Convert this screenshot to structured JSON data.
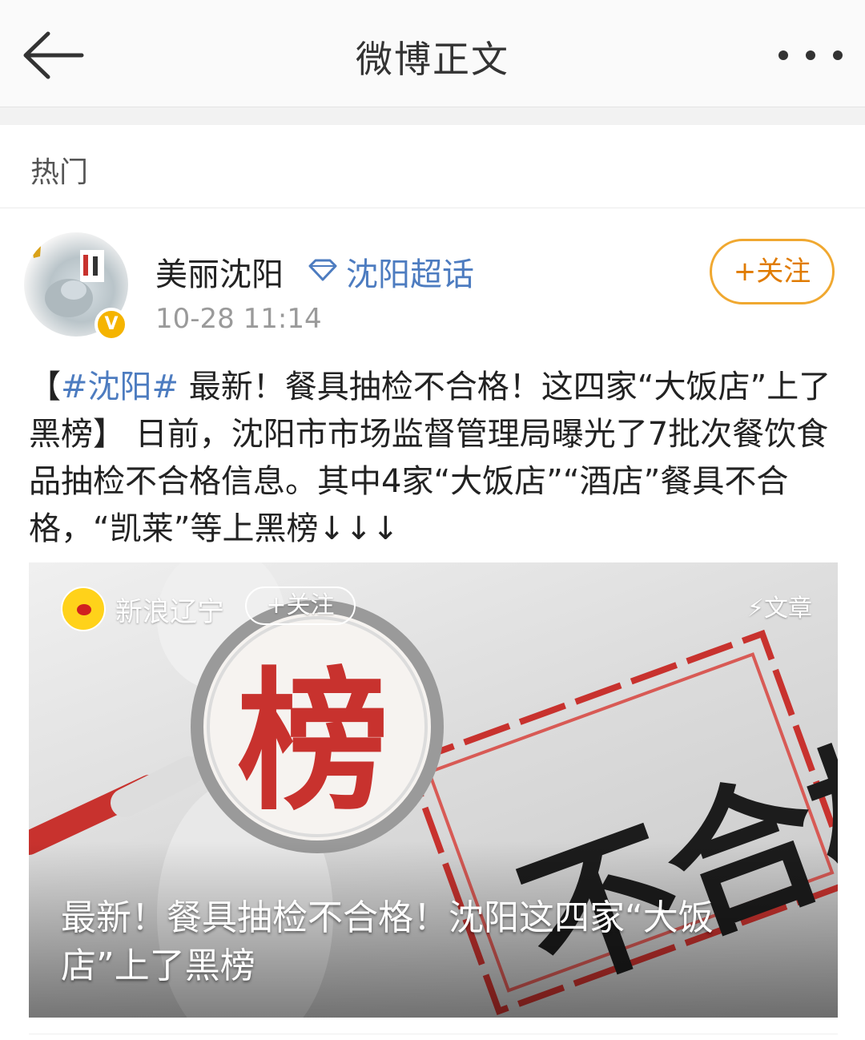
{
  "header": {
    "title": "微博正文",
    "back_icon": "arrow-left-icon",
    "more_icon": "more-horizontal-icon"
  },
  "section": {
    "label": "热门"
  },
  "post": {
    "username": "美丽沈阳",
    "topic_icon": "diamond-icon",
    "topic": "沈阳超话",
    "time": "10-28 11:14",
    "verified_badge": "V",
    "follow_label": "+关注",
    "body": {
      "open": "【",
      "hashtag": "#沈阳#",
      "text": "最新！餐具抽检不合格！这四家“大饭店”上了黑榜】 日前，沈阳市市场监督管理局曝光了7批次餐饮食品抽检不合格信息。其中4家“大饭店”“酒店”餐具不合格，“凯莱”等上黑榜↓↓↓"
    }
  },
  "card": {
    "source_name": "新浪辽宁",
    "follow_label": "+关注",
    "type_label": "⚡文章",
    "title": "最新！餐具抽检不合格！沈阳这四家“大饭店”上了黑榜",
    "stamp_text": "不合格",
    "magnifier_text": "榜"
  },
  "colors": {
    "link": "#4d7cc0",
    "follow_border": "#f0a830",
    "follow_text": "#e07b00",
    "stamp_red": "#c8322e"
  }
}
